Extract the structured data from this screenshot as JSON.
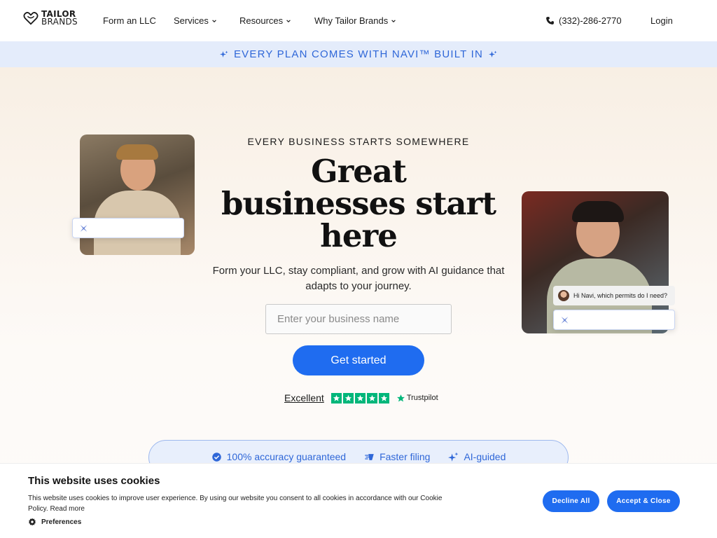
{
  "brand": {
    "line1": "TAILOR",
    "line2": "BRANDS"
  },
  "nav": {
    "items": [
      {
        "label": "Form an LLC",
        "dropdown": false
      },
      {
        "label": "Services",
        "dropdown": true
      },
      {
        "label": "Resources",
        "dropdown": true
      },
      {
        "label": "Why Tailor Brands",
        "dropdown": true
      }
    ],
    "phone": "(332)-286-2770",
    "login": "Login"
  },
  "banner": {
    "text": "EVERY PLAN COMES WITH NAVI™ BUILT IN"
  },
  "hero": {
    "eyebrow": "EVERY BUSINESS STARTS SOMEWHERE",
    "headline": "Great businesses start here",
    "subtitle": "Form your LLC, stay compliant, and grow with AI guidance that adapts to your journey.",
    "input_placeholder": "Enter your business name",
    "cta": "Get started",
    "rating_label": "Excellent",
    "rating_stars": 5,
    "trustpilot": "Trustpilot",
    "chat_message": "Hi Navi, which permits do I need?"
  },
  "features": [
    {
      "icon": "check-badge-icon",
      "label": "100% accuracy guaranteed"
    },
    {
      "icon": "speed-icon",
      "label": "Faster filing"
    },
    {
      "icon": "sparkle-icon",
      "label": "AI-guided"
    }
  ],
  "cookie": {
    "title": "This website uses cookies",
    "text": "This website uses cookies to improve user experience. By using our website you consent to all cookies in accordance with our Cookie Policy.",
    "read_more": "Read more",
    "preferences": "Preferences",
    "decline": "Decline All",
    "accept": "Accept & Close"
  },
  "colors": {
    "accent": "#1f6cf0",
    "banner_bg": "#e4ecfb",
    "trustpilot": "#00b67a"
  }
}
